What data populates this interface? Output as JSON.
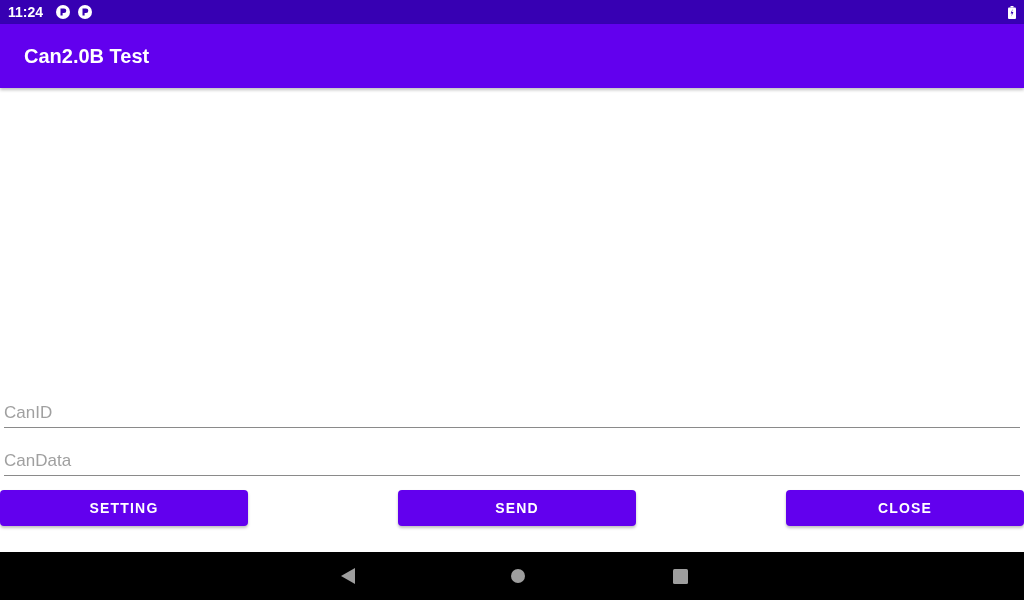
{
  "status_bar": {
    "time": "11:24"
  },
  "app_bar": {
    "title": "Can2.0B Test"
  },
  "fields": [
    {
      "placeholder": "CanID"
    },
    {
      "placeholder": "CanData"
    }
  ],
  "buttons": [
    "SETTING",
    "SEND",
    "CLOSE"
  ]
}
